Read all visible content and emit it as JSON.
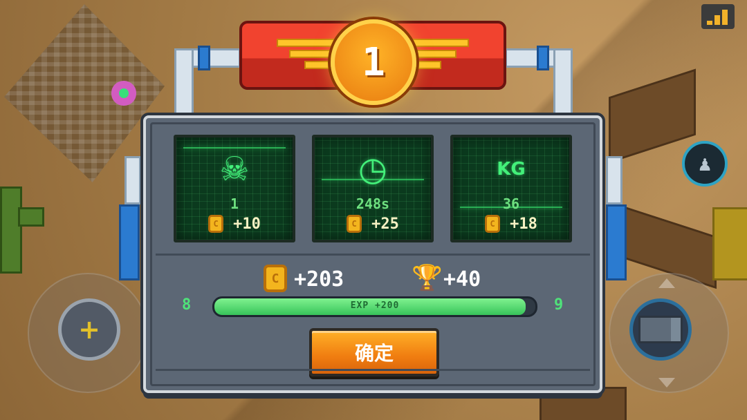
{
  "rank": "1",
  "stats": [
    {
      "icon": "skull-crossbones-icon",
      "glyph": "☠",
      "value": "1",
      "reward": "+10"
    },
    {
      "icon": "clock-icon",
      "glyph": "◷",
      "value": "248s",
      "reward": "+25"
    },
    {
      "icon": "weight-kg-icon",
      "glyph": "KG",
      "value": "36",
      "reward": "+18"
    }
  ],
  "coin_glyph": "C",
  "totals": {
    "coins": "+203",
    "trophies": "+40"
  },
  "level": {
    "current": "8",
    "next": "9",
    "exp_label": "EXP +200",
    "progress": 0.97
  },
  "confirm_label": "确定",
  "icons": {
    "trophy": "trophy-icon",
    "move": "plus-icon",
    "fire": "gun-icon",
    "team": "team-icon",
    "signal": "signal-icon"
  },
  "colors": {
    "accent_green": "#43f07a",
    "button_orange": "#f07d10",
    "coin_gold": "#f3b51e",
    "banner_red": "#f1432f"
  }
}
